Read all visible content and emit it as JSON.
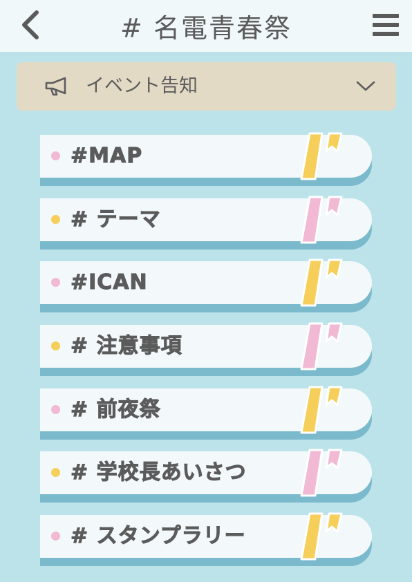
{
  "header": {
    "title": "# 名電青春祭",
    "back_icon": "chevron-left-icon",
    "menu_icon": "hamburger-menu-icon"
  },
  "dropdown": {
    "icon": "megaphone-icon",
    "label": "イベント告知",
    "chevron": "chevron-down-icon"
  },
  "colors": {
    "background": "#bce3ea",
    "header_bg": "#f1f8fa",
    "dropdown_bg": "#e3dac6",
    "pink": "#f1b9d4",
    "yellow": "#f6cf5a",
    "item_face": "#f3f9fb",
    "item_shadow": "#7bb9cc",
    "text": "#5b5b5b"
  },
  "items": [
    {
      "label": "#MAP",
      "accent": "pink",
      "quote": "yellow"
    },
    {
      "label": "# テーマ",
      "accent": "yellow",
      "quote": "pink"
    },
    {
      "label": "#ICAN",
      "accent": "pink",
      "quote": "yellow"
    },
    {
      "label": "# 注意事項",
      "accent": "yellow",
      "quote": "pink"
    },
    {
      "label": "# 前夜祭",
      "accent": "pink",
      "quote": "yellow"
    },
    {
      "label": "# 学校長あいさつ",
      "accent": "yellow",
      "quote": "pink"
    },
    {
      "label": "# スタンプラリー",
      "accent": "pink",
      "quote": "yellow"
    }
  ]
}
